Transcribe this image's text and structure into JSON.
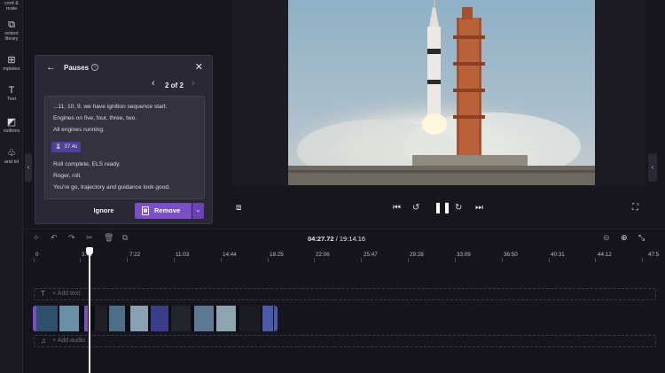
{
  "rail": {
    "items": [
      {
        "label": "cord &\nreate",
        "icon": "record-icon"
      },
      {
        "label": "ontent\nlibrary",
        "icon": "content-library-icon"
      },
      {
        "label": "mplates",
        "icon": "templates-icon"
      },
      {
        "label": "Text",
        "icon": "text-icon"
      },
      {
        "label": "nsitions",
        "icon": "transitions-icon"
      },
      {
        "label": "and kit",
        "icon": "brand-kit-icon"
      }
    ]
  },
  "pauses_panel": {
    "title": "Pauses",
    "pager": "2 of 2",
    "transcript_lines": [
      "...11, 10, 9, we have ignition sequence start.",
      "Engines on five, four, three, two.",
      "All engines running.",
      "Roll complete, ELS ready.",
      "Roger, roll.",
      "You're go, trajectory and guidance look good."
    ],
    "pause_duration": "37.4s",
    "ignore_label": "Ignore",
    "remove_label": "Remove"
  },
  "timeline": {
    "current_time": "04:27.72",
    "total_time": "19:14.16",
    "separator": "/",
    "ruler_labels": [
      "0",
      "3:41",
      "7:22",
      "11:03",
      "14:44",
      "18:25",
      "22:06",
      "25:47",
      "29:28",
      "33:09",
      "36:50",
      "40:31",
      "44:12",
      "47:5"
    ],
    "text_track_label": "+ Add text",
    "audio_track_label": "+ Add audio"
  },
  "colors": {
    "accent": "#7a4fc8",
    "panel_bg": "#2a2834",
    "app_bg": "#17161d"
  }
}
